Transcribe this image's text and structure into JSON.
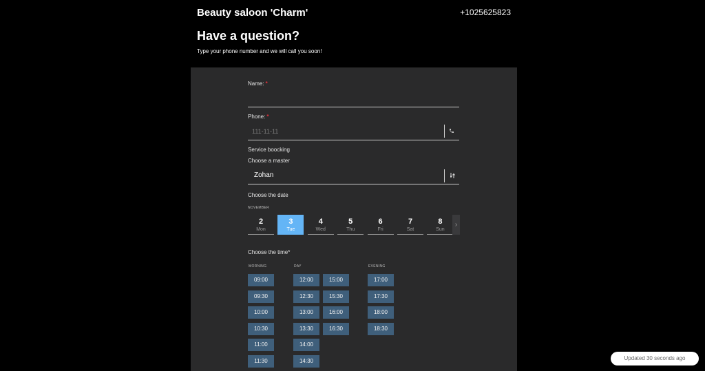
{
  "header": {
    "brand": "Beauty saloon 'Charm'",
    "phone": "+1025625823"
  },
  "intro": {
    "title": "Have a question?",
    "subtitle": "Type your phone number and we will call you soon!"
  },
  "form": {
    "name_label": "Name:",
    "name_required": "*",
    "name_value": "",
    "phone_label": "Phone:",
    "phone_required": "*",
    "phone_placeholder": "111-11-11",
    "phone_value": "",
    "phone_icon": "phone-icon",
    "service_label": "Service boocking",
    "master_label": "Choose a master",
    "master_value": "Zohan",
    "master_icon": "sort-arrows-icon",
    "date_label": "Choose the date",
    "month": "NOVEMBER",
    "days": [
      {
        "num": "2",
        "name": "Mon",
        "selected": false
      },
      {
        "num": "3",
        "name": "Tue",
        "selected": true
      },
      {
        "num": "4",
        "name": "Wed",
        "selected": false
      },
      {
        "num": "5",
        "name": "Thu",
        "selected": false
      },
      {
        "num": "6",
        "name": "Fri",
        "selected": false
      },
      {
        "num": "7",
        "name": "Sat",
        "selected": false
      },
      {
        "num": "8",
        "name": "Sun",
        "selected": false
      }
    ],
    "next_icon": "chevron-right-icon",
    "time_label": "Choose the time*",
    "morning_label": "MORNING",
    "day_label": "DAY",
    "evening_label": "EVENING",
    "morning_slots": [
      "09:00",
      "09:30",
      "10:00",
      "10:30",
      "11:00",
      "11:30"
    ],
    "day_slots_col1": [
      "12:00",
      "12:30",
      "13:00",
      "13:30",
      "14:00",
      "14:30"
    ],
    "day_slots_col2": [
      "15:00",
      "15:30",
      "16:00",
      "16:30"
    ],
    "evening_slots": [
      "17:00",
      "17:30",
      "18:00",
      "18:30"
    ]
  },
  "toast": {
    "text": "Updated 30 seconds ago"
  },
  "colors": {
    "accent": "#64b5f6",
    "slot": "#3f5f7b",
    "panel": "#2a2a2b",
    "required": "#e0313b"
  }
}
